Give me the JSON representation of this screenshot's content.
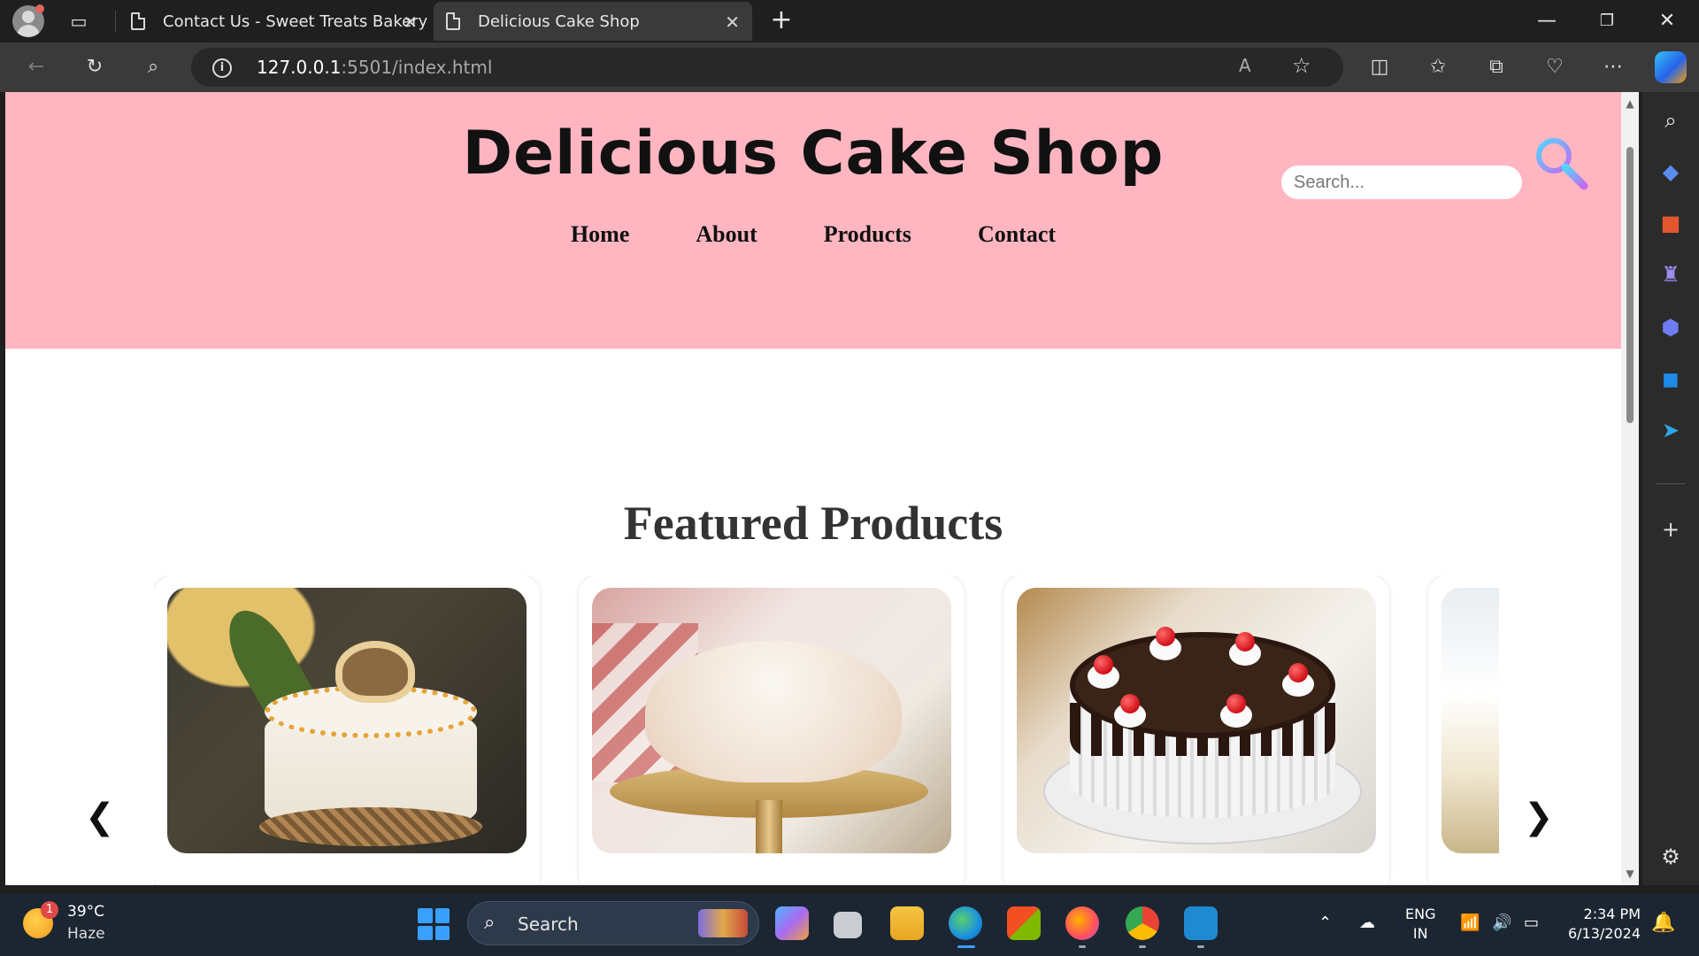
{
  "browser": {
    "tabs": [
      {
        "title": "Contact Us - Sweet Treats Bakery"
      },
      {
        "title": "Delicious Cake Shop",
        "active": true
      }
    ],
    "address": {
      "host": "127.0.0.1",
      "path": ":5501/index.html"
    },
    "window_controls": {
      "minimize": "—",
      "restore": "❐",
      "close": "✕"
    }
  },
  "page": {
    "site_title": "Delicious Cake Shop",
    "nav": [
      "Home",
      "About",
      "Products",
      "Contact"
    ],
    "search": {
      "placeholder": "Search...",
      "value": ""
    },
    "featured_heading": "Featured Products",
    "carousel": {
      "prev": "❮",
      "next": "❯",
      "products": [
        {
          "image": "pineapple-nest-cake"
        },
        {
          "image": "coconut-cake-on-stand"
        },
        {
          "image": "black-forest-cake"
        },
        {
          "image": "partially-visible-cake"
        }
      ]
    },
    "colors": {
      "header_bg": "#ffb6c1",
      "title": "#111111",
      "heading": "#333333"
    }
  },
  "sidebar_icons": [
    "search-icon",
    "tag-icon",
    "briefcase-icon",
    "games-icon",
    "copilot-app-icon",
    "outlook-icon",
    "telegram-icon",
    "add-icon",
    "settings-icon"
  ],
  "taskbar": {
    "weather": {
      "temp": "39°C",
      "desc": "Haze",
      "badge": "1"
    },
    "search_label": "Search",
    "language": {
      "line1": "ENG",
      "line2": "IN"
    },
    "clock": {
      "time": "2:34 PM",
      "date": "6/13/2024"
    }
  }
}
